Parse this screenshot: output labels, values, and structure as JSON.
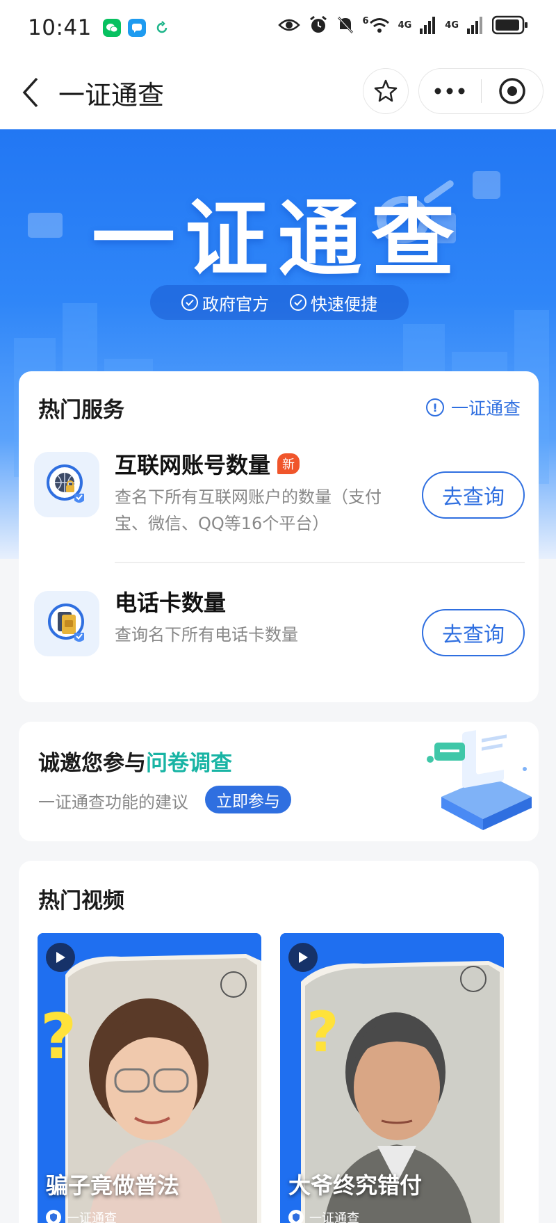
{
  "status_bar": {
    "time": "10:41",
    "network_labels": [
      "6",
      "4G",
      "4G"
    ]
  },
  "nav": {
    "title": "一证通查"
  },
  "banner": {
    "title": "一证通查",
    "tags": [
      "政府官方",
      "快速便捷"
    ]
  },
  "services": {
    "section_title": "热门服务",
    "header_link": "一证通查",
    "items": [
      {
        "name": "互联网账号数量",
        "badge": "新",
        "description": "查名下所有互联网账户的数量（支付宝、微信、QQ等16个平台）",
        "button": "去查询"
      },
      {
        "name": "电话卡数量",
        "description": "查询名下所有电话卡数量",
        "button": "去查询"
      }
    ]
  },
  "survey": {
    "title_prefix": "诚邀您参与",
    "title_highlight": "问卷调查",
    "subtitle": "一证通查功能的建议",
    "button": "立即参与"
  },
  "videos": {
    "section_title": "热门视频",
    "items": [
      {
        "caption": "骗子竟做普法",
        "source": "一证通查"
      },
      {
        "caption": "大爷终究错付",
        "source": "一证通查"
      }
    ]
  },
  "colors": {
    "accent": "#2f6fe0",
    "banner": "#2277f3",
    "highlight": "#18b4a4",
    "new_badge": "#f0552b"
  }
}
